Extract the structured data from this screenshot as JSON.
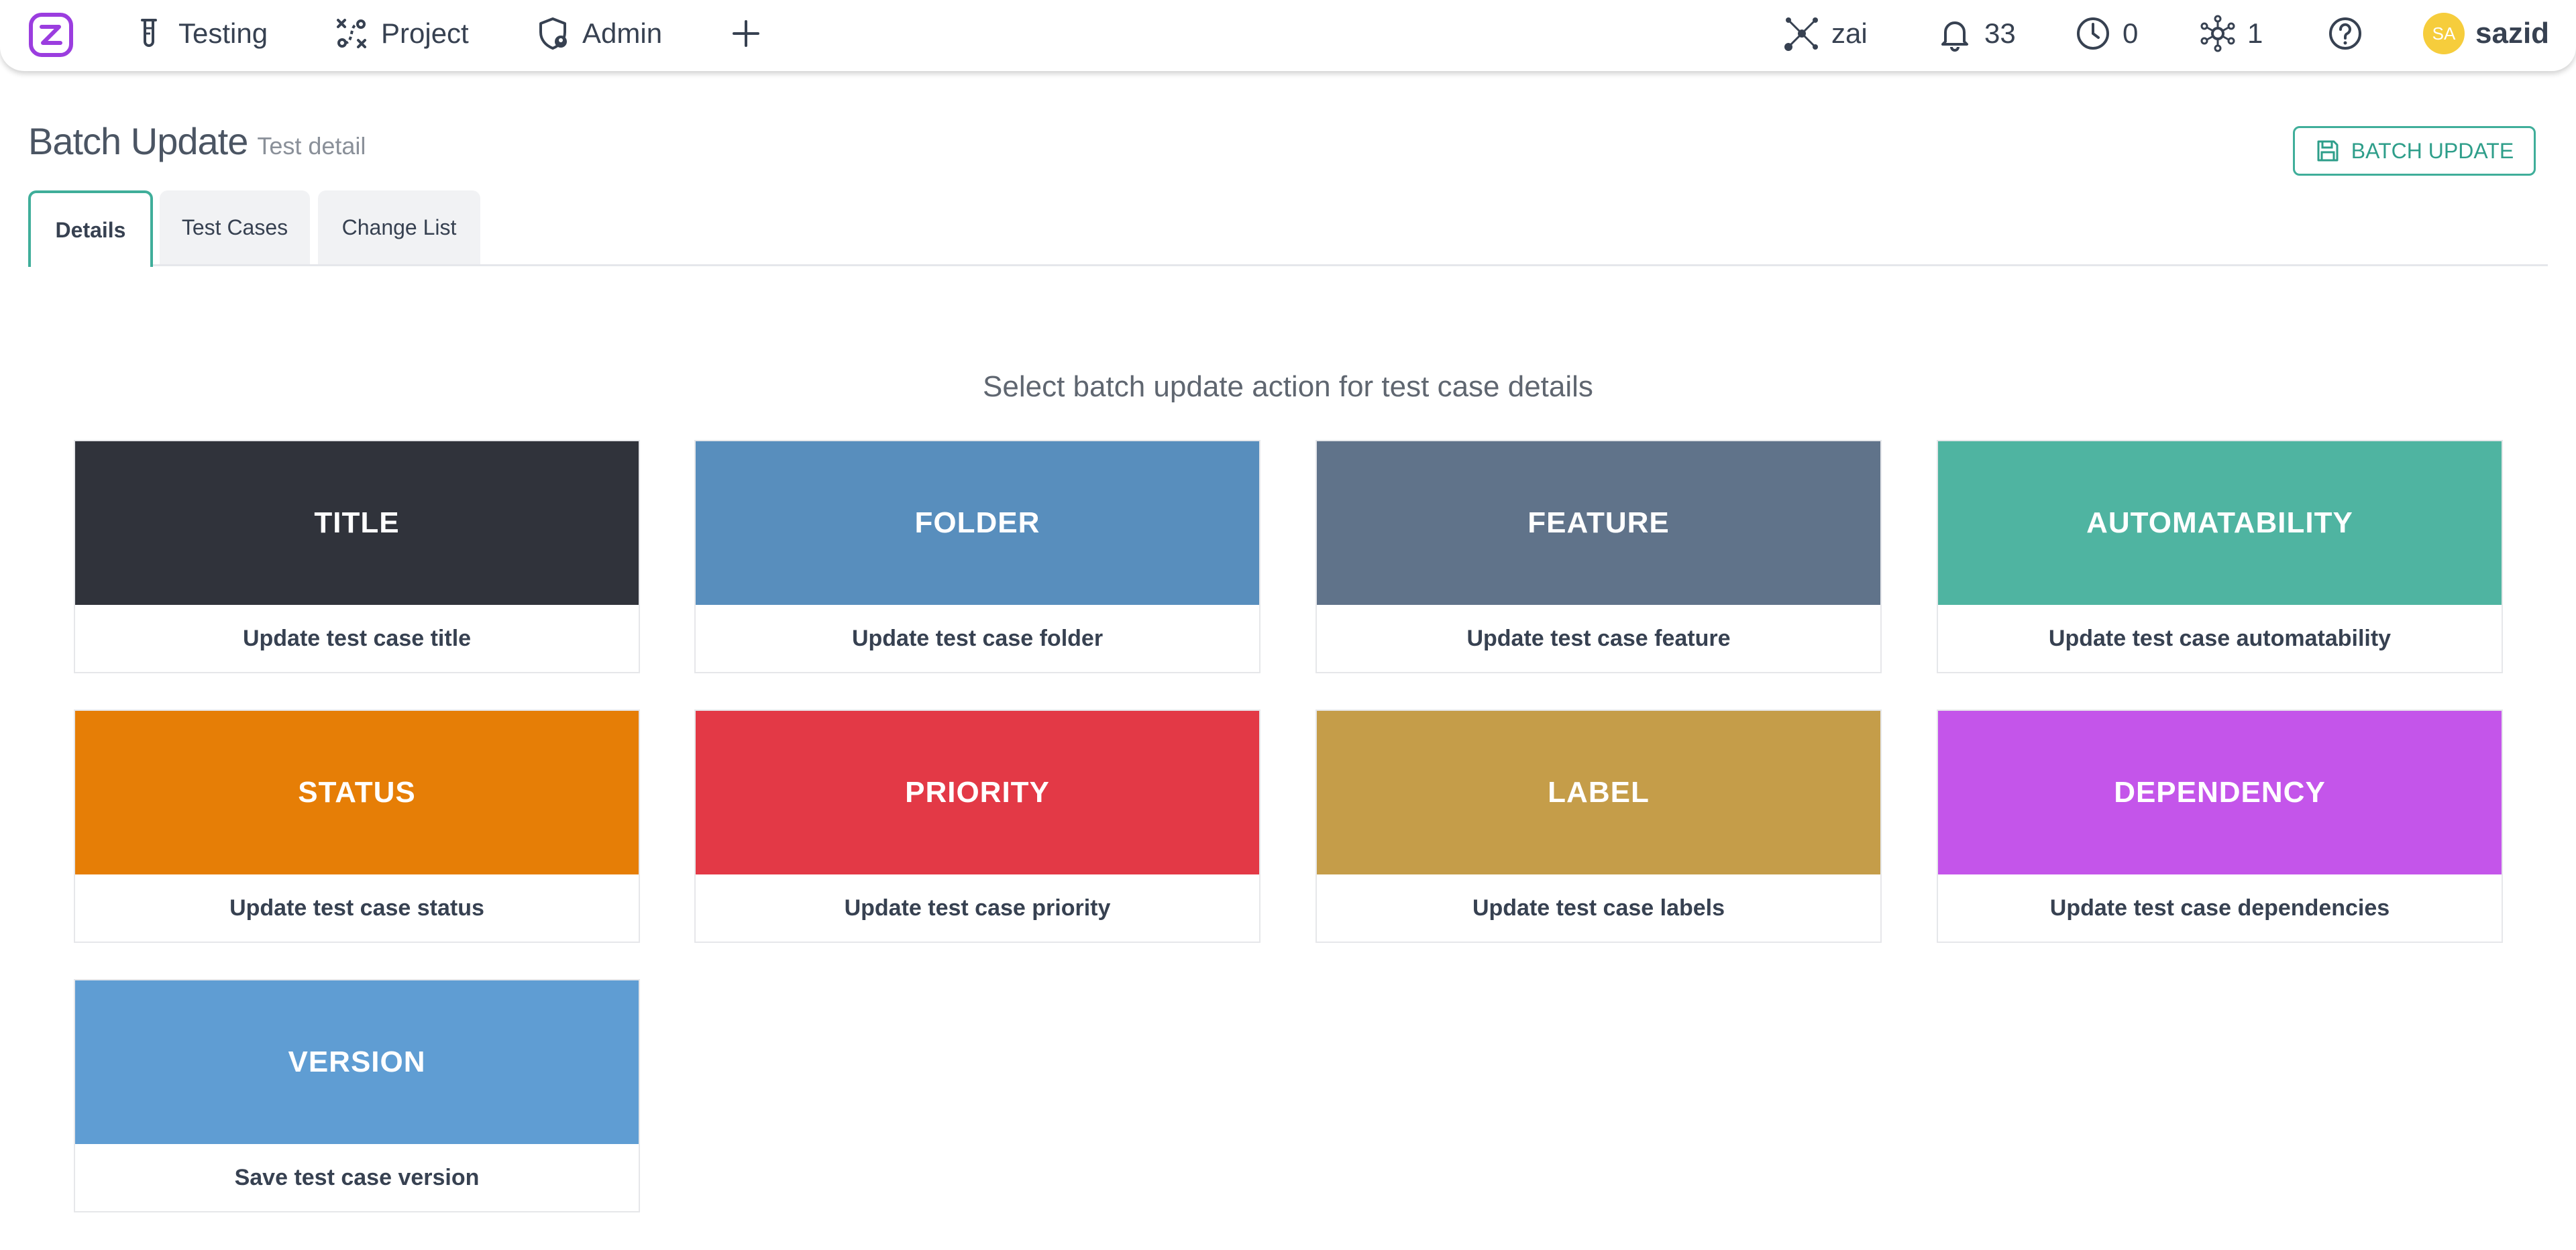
{
  "nav": {
    "items": [
      {
        "label": "Testing",
        "icon": "test-tube-icon"
      },
      {
        "label": "Project",
        "icon": "route-icon"
      },
      {
        "label": "Admin",
        "icon": "shield-icon"
      }
    ],
    "add_icon": "plus-icon",
    "right": {
      "zai_label": "zai",
      "notifications_count": "33",
      "clock_count": "0",
      "network_count": "1",
      "help_icon": "help-icon",
      "avatar_initials": "SA",
      "user_name": "sazid"
    },
    "brand_color": "#9b3ddf"
  },
  "header": {
    "title": "Batch Update",
    "subtitle": "Test detail",
    "batch_button_label": "BATCH UPDATE",
    "accent_color": "#3fae9a"
  },
  "tabs": [
    {
      "label": "Details",
      "active": true
    },
    {
      "label": "Test Cases",
      "active": false
    },
    {
      "label": "Change List",
      "active": false
    }
  ],
  "main": {
    "instruction": "Select batch update action for test case details",
    "cards": [
      {
        "title": "TITLE",
        "description": "Update test case title",
        "color": "#30333b"
      },
      {
        "title": "FOLDER",
        "description": "Update test case folder",
        "color": "#588ebd"
      },
      {
        "title": "FEATURE",
        "description": "Update test case feature",
        "color": "#60738a"
      },
      {
        "title": "AUTOMATABILITY",
        "description": "Update test case automatability",
        "color": "#4fb4a1"
      },
      {
        "title": "STATUS",
        "description": "Update test case status",
        "color": "#e67e06"
      },
      {
        "title": "PRIORITY",
        "description": "Update test case priority",
        "color": "#e33946"
      },
      {
        "title": "LABEL",
        "description": "Update test case labels",
        "color": "#c59d49"
      },
      {
        "title": "DEPENDENCY",
        "description": "Update test case dependencies",
        "color": "#c455ea"
      },
      {
        "title": "VERSION",
        "description": "Save test case version",
        "color": "#5f9dd3"
      }
    ]
  }
}
